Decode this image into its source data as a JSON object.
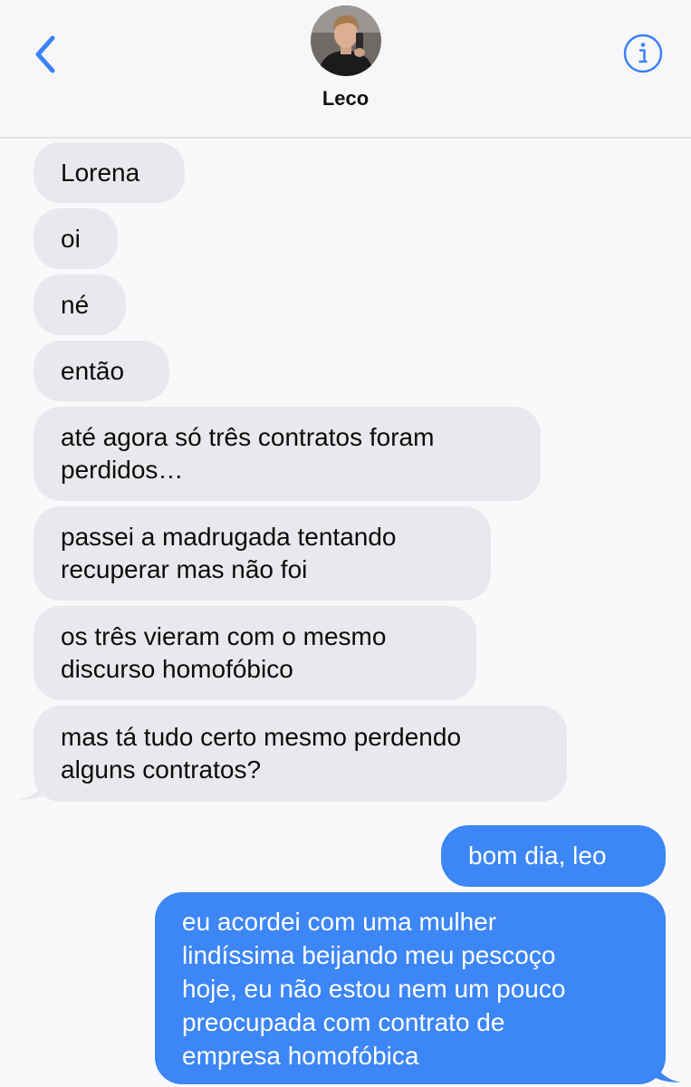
{
  "header": {
    "contact_name": "Leco",
    "back_icon": "chevron-left-icon",
    "info_icon": "info-icon",
    "accent_color": "#3b82f6"
  },
  "messages": [
    {
      "direction": "incoming",
      "text": "Lorena"
    },
    {
      "direction": "incoming",
      "text": "oi"
    },
    {
      "direction": "incoming",
      "text": "né"
    },
    {
      "direction": "incoming",
      "text": "então"
    },
    {
      "direction": "incoming",
      "text": "até agora só três contratos foram\nperdidos…"
    },
    {
      "direction": "incoming",
      "text": "passei a madrugada tentando\nrecuperar mas não foi"
    },
    {
      "direction": "incoming",
      "text": "os três vieram com o mesmo\ndiscurso homofóbico"
    },
    {
      "direction": "incoming",
      "text": "mas tá tudo certo mesmo perdendo\nalguns contratos?"
    },
    {
      "direction": "outgoing",
      "text": "bom dia, leo"
    },
    {
      "direction": "outgoing",
      "text": "eu acordei com uma mulher\nlindíssima beijando meu pescoço\nhoje, eu não estou nem um pouco\npreocupada com contrato de\nempresa homofóbica"
    }
  ],
  "colors": {
    "incoming_bubble": "#e9e9ed",
    "outgoing_bubble": "#3c86f5",
    "header_background": "#f7f7f9"
  }
}
